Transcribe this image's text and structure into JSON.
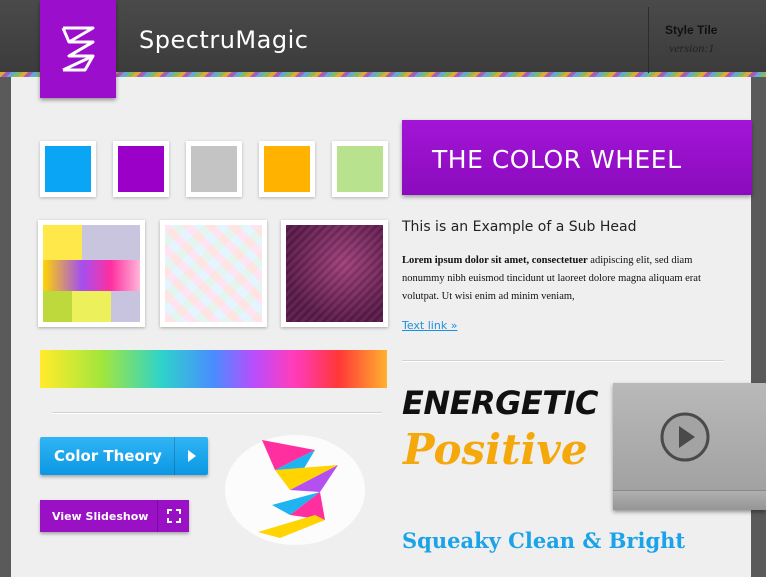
{
  "header": {
    "title": "SpectruMagic",
    "style_tile_label": "Style Tile",
    "style_tile_version": "version:1"
  },
  "swatches": [
    {
      "name": "blue",
      "color": "#0aa5f5"
    },
    {
      "name": "purple",
      "color": "#9a00c8"
    },
    {
      "name": "gray",
      "color": "#c4c4c4"
    },
    {
      "name": "orange",
      "color": "#ffb300"
    },
    {
      "name": "light-green",
      "color": "#b9e28e"
    }
  ],
  "textures": [
    "rainbow-blocks",
    "pastel-pattern",
    "plum-texture"
  ],
  "buttons": {
    "primary_label": "Color Theory",
    "secondary_label": "View Slideshow"
  },
  "banner": {
    "title": "THE COLOR WHEEL"
  },
  "content": {
    "subhead": "This is an Example of a Sub Head",
    "body_bold": "Lorem ipsum dolor sit amet, consectetuer",
    "body_rest": " adipiscing elit, sed diam nonummy nibh euismod tincidunt ut laoreet dolore magna aliquam erat volutpat. Ut wisi enim ad minim veniam,",
    "link_text": "Text link »"
  },
  "typography": {
    "energetic": "ENERGETIC",
    "positive": "Positive",
    "squeaky": "Squeaky Clean & Bright"
  },
  "colors": {
    "accent_purple": "#9a00c8",
    "accent_blue": "#0aa5f5",
    "accent_orange": "#f4a80c"
  },
  "icons": {
    "logo": "spectrumagic-logo-icon",
    "primary_button": "chevron-right-icon",
    "secondary_button": "expand-icon",
    "video": "play-icon"
  }
}
